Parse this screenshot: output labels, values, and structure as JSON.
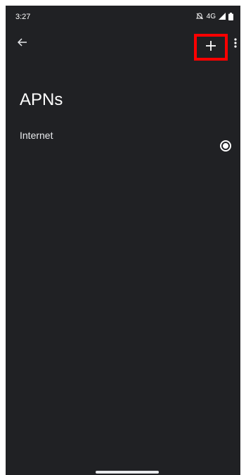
{
  "status_bar": {
    "time": "3:27",
    "network": "4G",
    "icons": [
      "mute-icon",
      "signal-icon",
      "battery-icon"
    ]
  },
  "app_bar": {
    "back_icon": "arrow-back-icon",
    "add_icon": "plus-icon",
    "overflow_icon": "more-vert-icon",
    "highlight_color": "#ff0000"
  },
  "page": {
    "title": "APNs"
  },
  "apn_list": [
    {
      "name": "Internet",
      "selected": true
    }
  ],
  "colors": {
    "background": "#202124",
    "text": "#e8eaed",
    "accent": "#ffffff"
  }
}
